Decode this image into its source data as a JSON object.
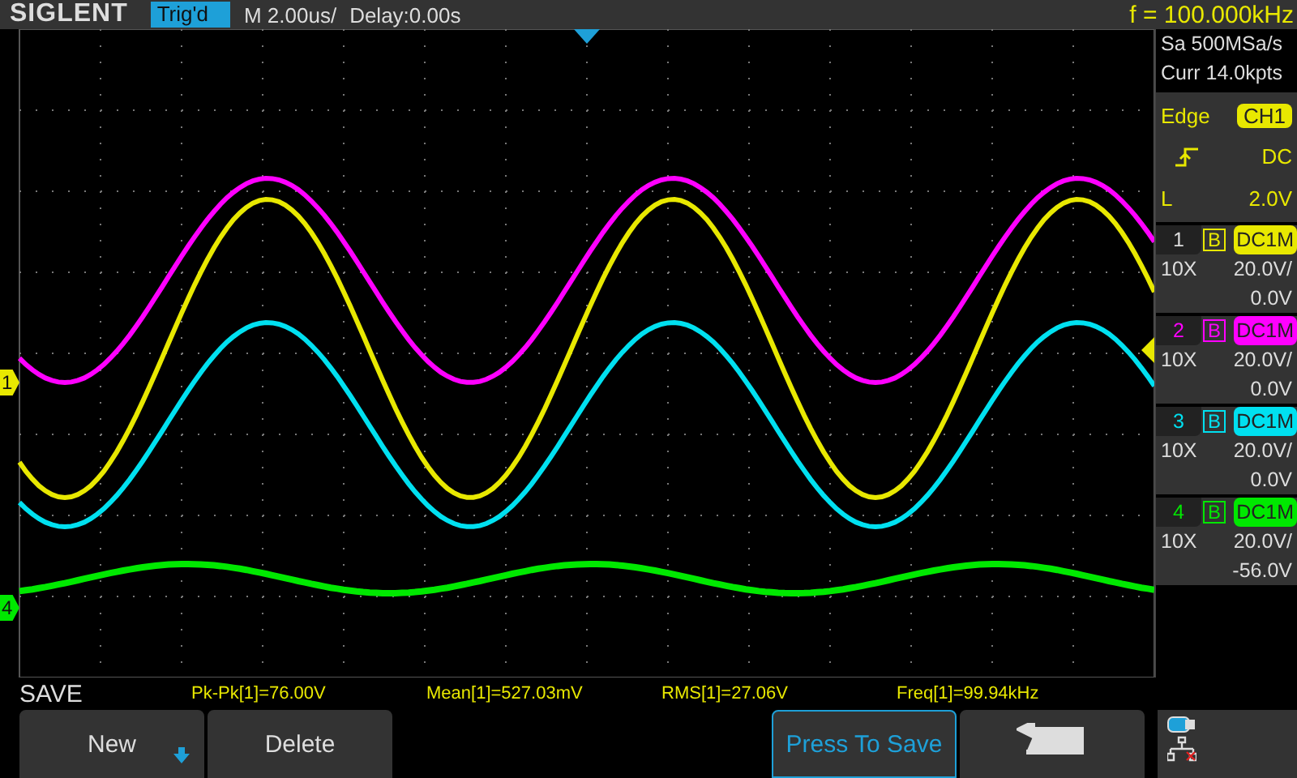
{
  "header": {
    "brand": "SIGLENT",
    "trigger_status": "Trig'd",
    "timebase": "M 2.00us/",
    "delay": "Delay:0.00s",
    "frequency": "f = 100.000kHz"
  },
  "acquisition": {
    "sample_rate": "Sa 500MSa/s",
    "memory_depth": "Curr 14.0kpts"
  },
  "trigger": {
    "type": "Edge",
    "source": "CH1",
    "coupling": "DC",
    "level_label": "L",
    "level": "2.0V"
  },
  "channels": [
    {
      "number": "1",
      "bandwidth": "B",
      "coupling": "DC1M",
      "probe": "10X",
      "scale": "20.0V/",
      "offset": "0.0V",
      "color": "#e8e800"
    },
    {
      "number": "2",
      "bandwidth": "B",
      "coupling": "DC1M",
      "probe": "10X",
      "scale": "20.0V/",
      "offset": "0.0V",
      "color": "#ff00ff"
    },
    {
      "number": "3",
      "bandwidth": "B",
      "coupling": "DC1M",
      "probe": "10X",
      "scale": "20.0V/",
      "offset": "0.0V",
      "color": "#00e0f0"
    },
    {
      "number": "4",
      "bandwidth": "B",
      "coupling": "DC1M",
      "probe": "10X",
      "scale": "20.0V/",
      "offset": "-56.0V",
      "color": "#00e800"
    }
  ],
  "channel_markers": [
    {
      "label": "1",
      "color": "#e8e800"
    },
    {
      "label": "4",
      "color": "#00e800"
    }
  ],
  "menu_title": "SAVE",
  "measurements": [
    "Pk-Pk[1]=76.00V",
    "Mean[1]=527.03mV",
    "RMS[1]=27.06V",
    "Freq[1]=99.94kHz"
  ],
  "softkeys": [
    {
      "kind": "menu",
      "label": "New",
      "dropdown": true,
      "active": false
    },
    {
      "kind": "menu",
      "label": "Delete",
      "dropdown": false,
      "active": false
    },
    {
      "kind": "empty"
    },
    {
      "kind": "empty"
    },
    {
      "kind": "menu",
      "label": "Press To Save",
      "dropdown": false,
      "active": true
    },
    {
      "kind": "back"
    }
  ]
}
